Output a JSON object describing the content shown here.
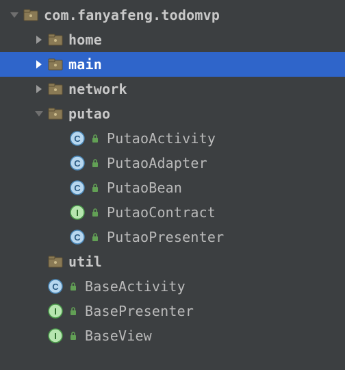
{
  "root": {
    "label": "com.fanyafeng.todomvp"
  },
  "home": {
    "label": "home"
  },
  "main": {
    "label": "main"
  },
  "network": {
    "label": "network"
  },
  "putao": {
    "label": "putao"
  },
  "putao_children": {
    "activity": {
      "label": "PutaoActivity",
      "kind": "C"
    },
    "adapter": {
      "label": "PutaoAdapter",
      "kind": "C"
    },
    "bean": {
      "label": "PutaoBean",
      "kind": "C"
    },
    "contract": {
      "label": "PutaoContract",
      "kind": "I"
    },
    "presenter": {
      "label": "PutaoPresenter",
      "kind": "C"
    }
  },
  "util": {
    "label": "util"
  },
  "base": {
    "activity": {
      "label": "BaseActivity",
      "kind": "C"
    },
    "presenter": {
      "label": "BasePresenter",
      "kind": "I"
    },
    "view": {
      "label": "BaseView",
      "kind": "I"
    }
  },
  "colors": {
    "class_bg": "#b7d7ef",
    "class_ring": "#4a87b7",
    "class_letter": "#2a5a82",
    "iface_bg": "#b7e6b0",
    "iface_ring": "#4a9a4a",
    "iface_letter": "#2a6a2a",
    "lock": "#62a055",
    "arrow": "#9a9a9a",
    "arrow_open": "#6f6f6f",
    "sel_arrow": "#ffffff"
  }
}
